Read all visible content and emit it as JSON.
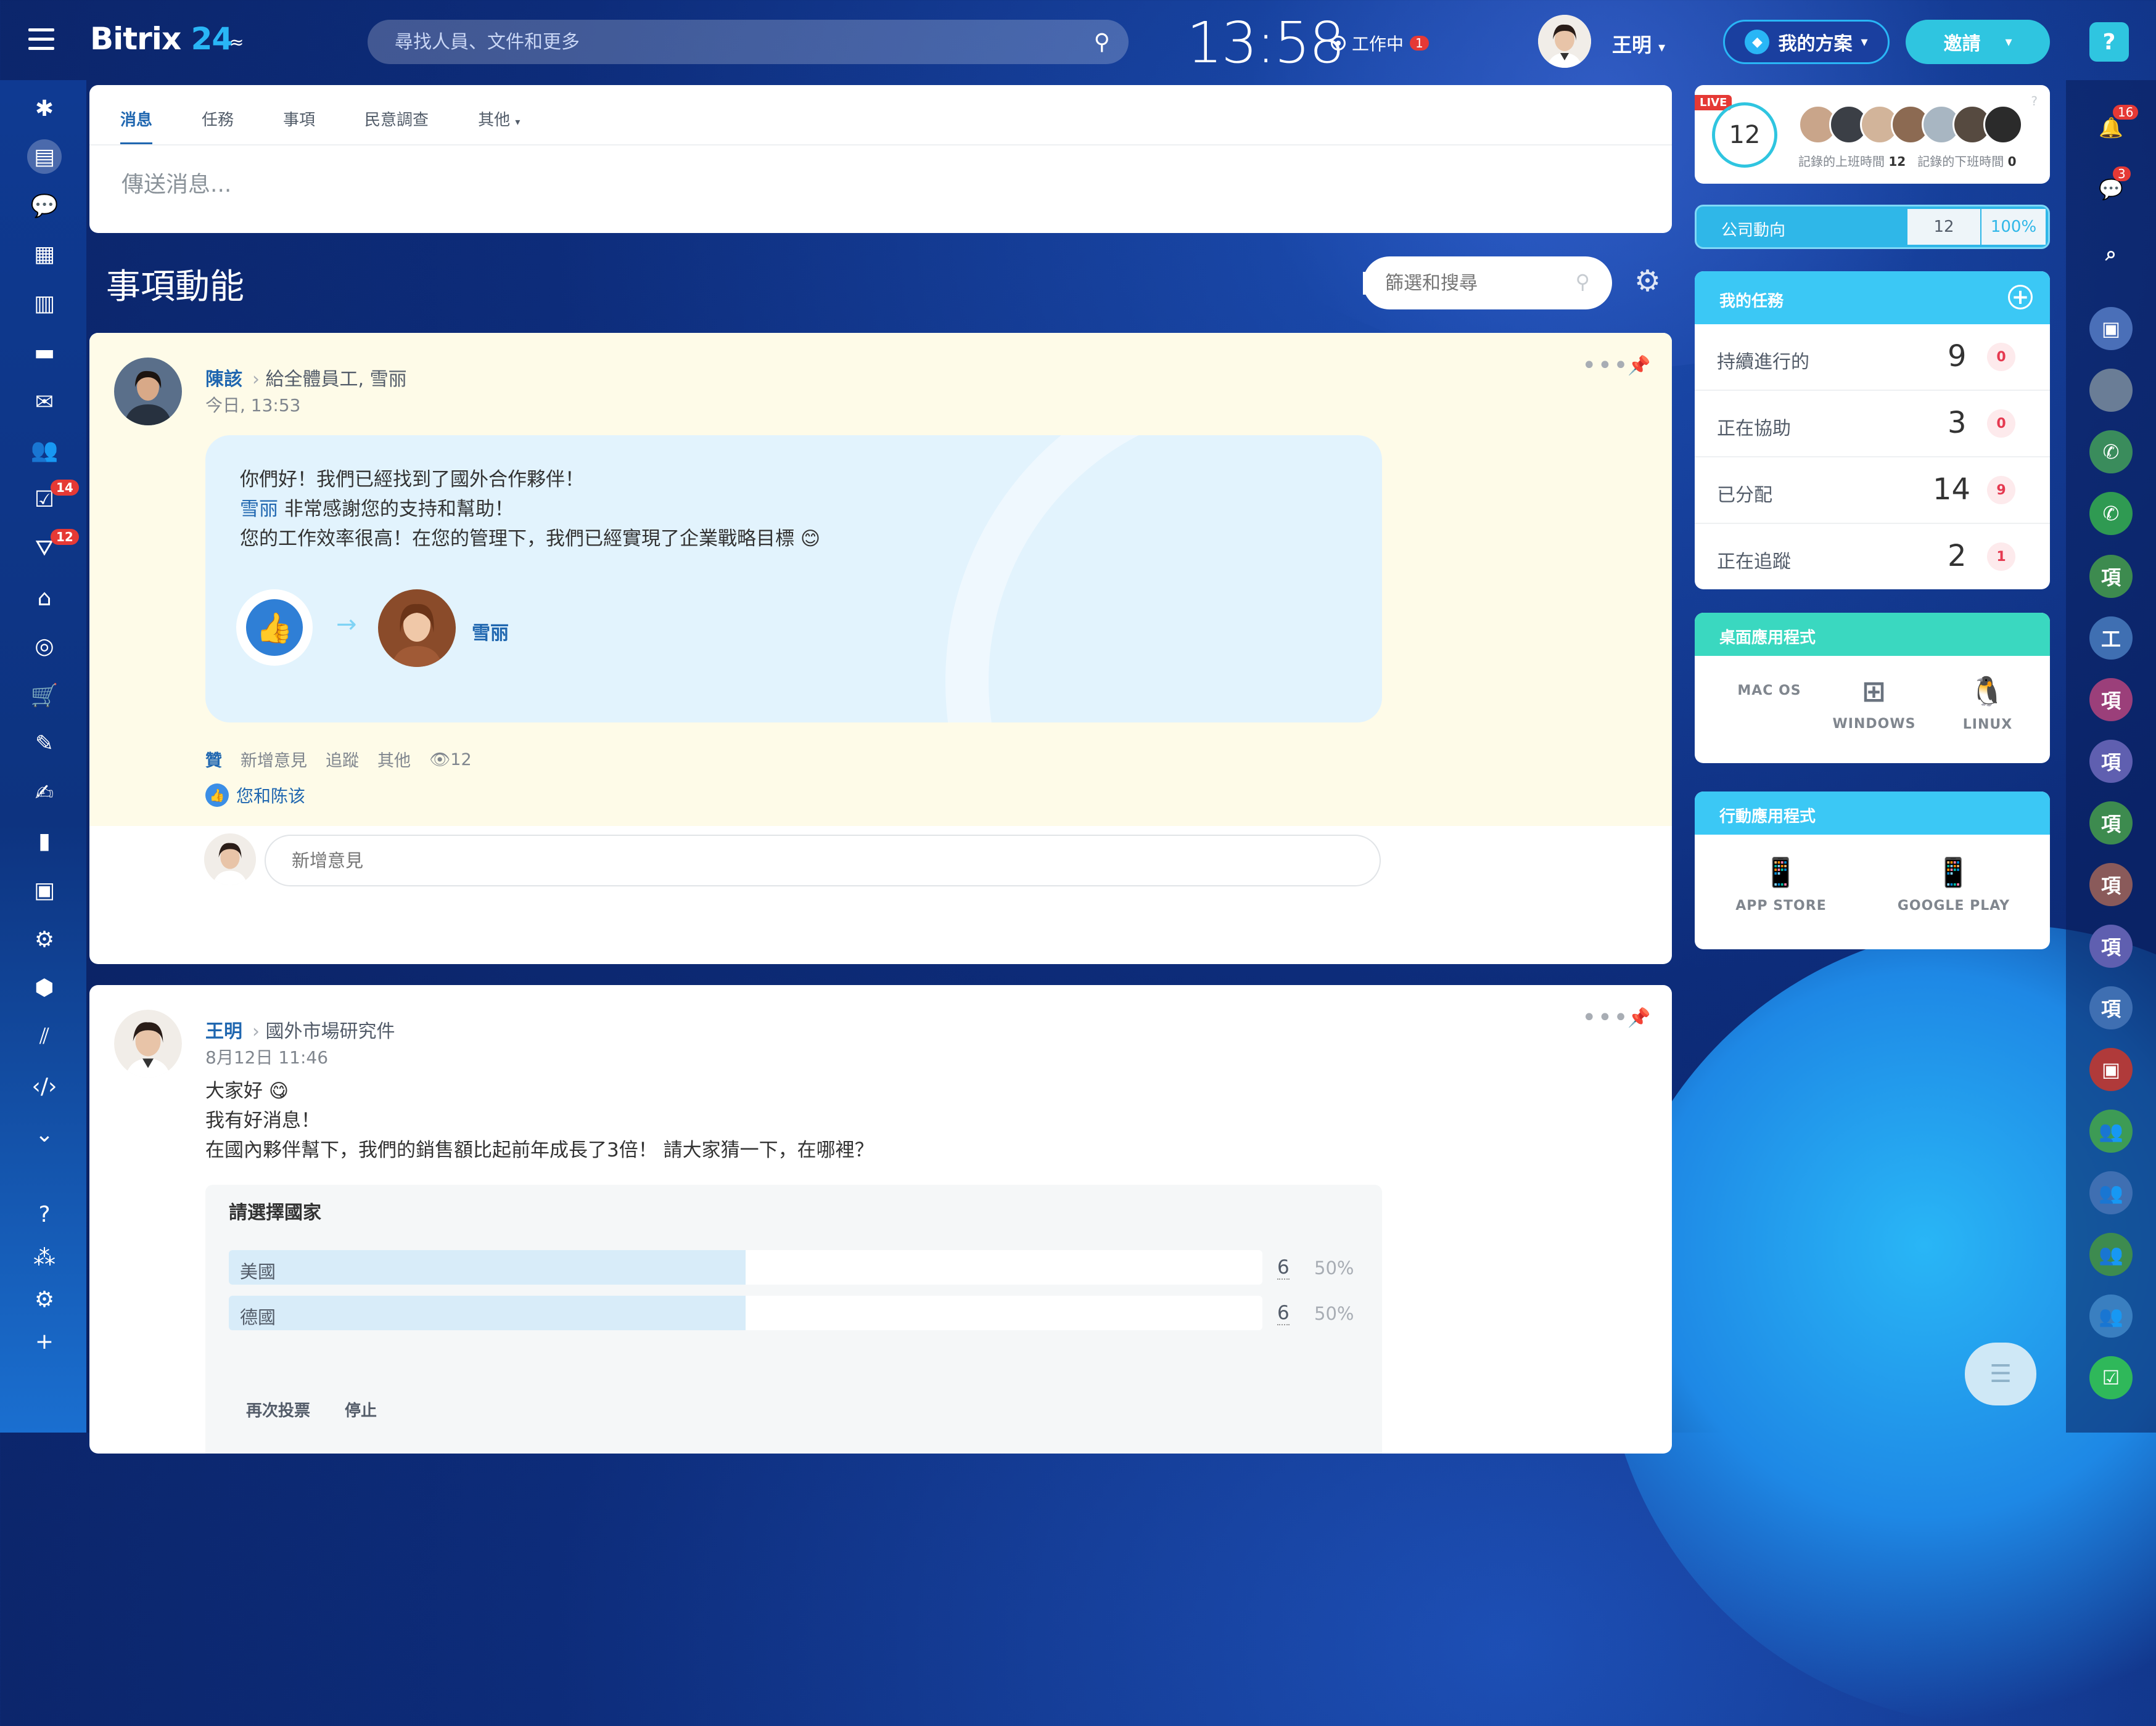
{
  "header": {
    "logo_main": "Bitrix",
    "logo_num": "24",
    "logo_sub": "≈",
    "search_placeholder": "尋找人員、文件和更多",
    "clock": "13:58",
    "work_status": "工作中",
    "work_badge": "1",
    "user_name": "王明",
    "plan_label": "我的方案",
    "invite_label": "邀請",
    "help": "?"
  },
  "left_sidebar": {
    "badges": {
      "tasks": "14",
      "filter": "12"
    }
  },
  "composer": {
    "tabs": [
      "消息",
      "任務",
      "事項",
      "民意調查",
      "其他"
    ],
    "input_placeholder": "傳送消息..."
  },
  "stream": {
    "title": "事項動能",
    "filter_placeholder": "篩選和搜尋"
  },
  "post1": {
    "author": "陳該",
    "recipient": "給全體員工, 雪丽",
    "time": "今日, 13:53",
    "line1": "你們好！我們已經找到了國外合作夥伴！",
    "mention": "雪丽",
    "line2": " 非常感謝您的支持和幫助！",
    "line3": "您的工作效率很高！在您的管理下，我們已經實現了企業戰略目標",
    "grat_name": "雪丽",
    "actions": {
      "like": "贊",
      "comment": "新增意見",
      "follow": "追蹤",
      "more": "其他",
      "views": "12"
    },
    "likers": "您和陈该",
    "comment_placeholder": "新增意見"
  },
  "post2": {
    "author": "王明",
    "recipient": "國外市場研究件",
    "time": "8月12日 11:46",
    "line1": "大家好",
    "line2": "我有好消息！",
    "line3": "在國內夥伴幫下，我們的銷售額比起前年成長了3倍！ 請大家猜一下，在哪裡？",
    "poll": {
      "title": "請選擇國家",
      "options": [
        {
          "label": "美國",
          "count": "6",
          "pct": "50%",
          "share": 0.5
        },
        {
          "label": "德國",
          "count": "6",
          "pct": "50%",
          "share": 0.5
        }
      ],
      "revote": "再次投票",
      "stop": "停止"
    }
  },
  "live_widget": {
    "tag": "LIVE",
    "count": "12",
    "checked_in_label": "記錄的上班時間",
    "checked_in": "12",
    "checked_out_label": "記錄的下班時間",
    "checked_out": "0",
    "help": "?"
  },
  "company_pulse": {
    "label": "公司動向",
    "value": "12",
    "pct": "100%"
  },
  "my_tasks": {
    "title": "我的任務",
    "rows": [
      {
        "label": "持續進行的",
        "count": "9",
        "badge": "0"
      },
      {
        "label": "正在協助",
        "count": "3",
        "badge": "0"
      },
      {
        "label": "已分配",
        "count": "14",
        "badge": "9"
      },
      {
        "label": "正在追蹤",
        "count": "2",
        "badge": "1"
      }
    ]
  },
  "desktop_apps": {
    "title": "桌面應用程式",
    "items": [
      "MAC OS",
      "WINDOWS",
      "LINUX"
    ]
  },
  "mobile_apps": {
    "title": "行動應用程式",
    "items": [
      "APP STORE",
      "GOOGLE PLAY"
    ]
  },
  "right_bar": {
    "notif_badge": "16",
    "chat_badge": "3",
    "items": [
      "項",
      "工",
      "項",
      "項",
      "項",
      "項",
      "項",
      "項"
    ]
  },
  "colors": {
    "accent": "#2fc5e0",
    "link": "#2067b0",
    "badge": "#e53935",
    "task_head": "#3bc8f5",
    "desk_head": "#3ad8c0"
  }
}
